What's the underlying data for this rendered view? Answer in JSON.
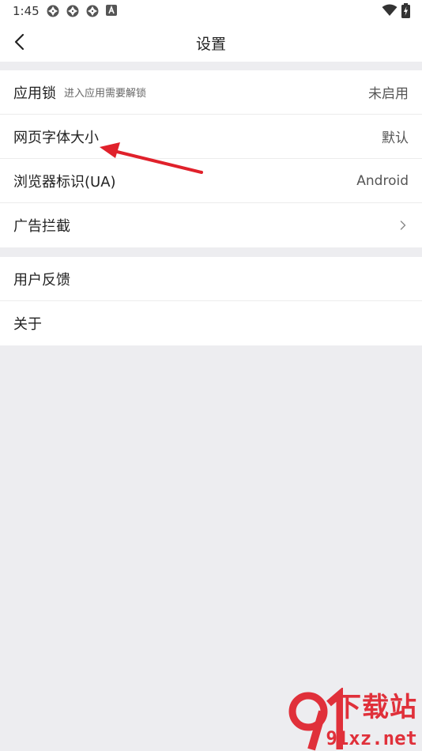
{
  "status_bar": {
    "time": "1:45",
    "notification_icons": [
      "aperture-icon",
      "aperture-icon",
      "aperture-icon",
      "a-box-icon"
    ],
    "right_icons": [
      "wifi-icon",
      "battery-charging-icon"
    ]
  },
  "header": {
    "title": "设置",
    "back_icon": "chevron-left-icon"
  },
  "group1": {
    "items": [
      {
        "title": "应用锁",
        "subtitle": "进入应用需要解锁",
        "value": "未启用"
      },
      {
        "title": "网页字体大小",
        "value": "默认"
      },
      {
        "title": "浏览器标识(UA)",
        "value": "Android"
      },
      {
        "title": "广告拦截",
        "icon": "chevron-right-icon"
      }
    ]
  },
  "group2": {
    "items": [
      {
        "title": "用户反馈"
      },
      {
        "title": "关于"
      }
    ]
  },
  "annotation": {
    "color": "#e0212b",
    "points_to": "网页字体大小"
  },
  "watermark": {
    "line1": "下载站",
    "line2": "91xz.net",
    "color": "#e0303a"
  },
  "colors": {
    "background": "#ededf0",
    "surface": "#ffffff",
    "text": "#222222",
    "secondary": "#555555"
  }
}
